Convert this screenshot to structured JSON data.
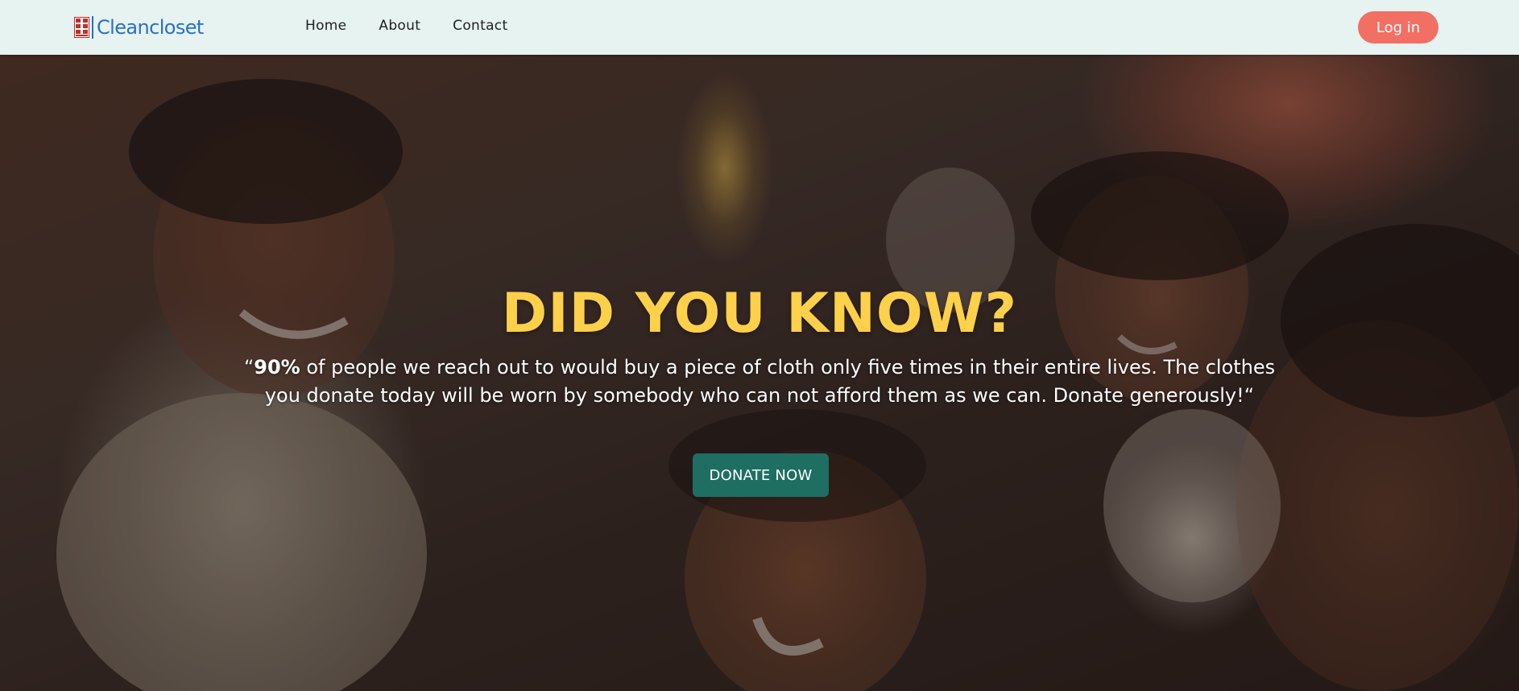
{
  "navbar": {
    "brand_name": "Cleancloset",
    "brand_logo": "cleancloset-logo-icon",
    "links": [
      "Home",
      "About",
      "Contact"
    ],
    "login_label": "Log in",
    "background": "#e6f3f1",
    "brand_color": "#2b6fc4",
    "login_color": "#f26f64"
  },
  "hero": {
    "image": "photo of smiling children reaching toward the camera",
    "title": "DID YOU KNOW?",
    "quote_open": "“",
    "quote_highlight": "90%",
    "quote_rest": " of people we reach out to would buy a piece of cloth only five times in their entire lives. The clothes you donate today will be worn by somebody who can not afford them as we can. Donate generously!“",
    "donate_label": "DONATE NOW",
    "title_color": "#ffd04a",
    "donate_color": "#1f6e62"
  }
}
